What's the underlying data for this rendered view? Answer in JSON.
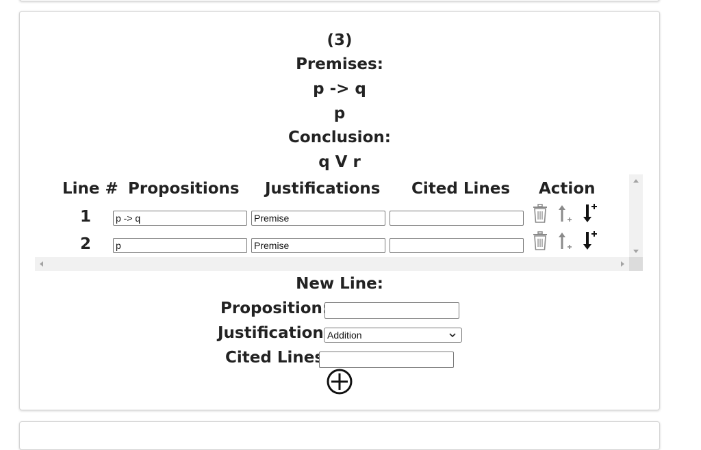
{
  "problem": {
    "number": "(3)",
    "premises_label": "Premises:",
    "premises": [
      "p -> q",
      "p"
    ],
    "conclusion_label": "Conclusion:",
    "conclusion": "q V r"
  },
  "table": {
    "headers": [
      "Line #",
      "Propositions",
      "Justifications",
      "Cited Lines",
      "Action"
    ],
    "rows": [
      {
        "line": "1",
        "proposition": "p -> q",
        "justification": "Premise",
        "cited": ""
      },
      {
        "line": "2",
        "proposition": "p",
        "justification": "Premise",
        "cited": ""
      }
    ],
    "action_icons": [
      "trash-icon",
      "insert-above-icon",
      "insert-below-icon"
    ]
  },
  "new_line": {
    "title": "New Line:",
    "proposition_label": "Proposition:",
    "proposition_value": "",
    "justification_label": "Justification:",
    "justification_selected": "Addition",
    "cited_label": "Cited Lines:",
    "cited_value": "",
    "add_icon": "plus-circle-icon"
  },
  "colors": {
    "text": "#222222",
    "icon_muted": "#8a8a8a",
    "icon_dark": "#111111"
  }
}
